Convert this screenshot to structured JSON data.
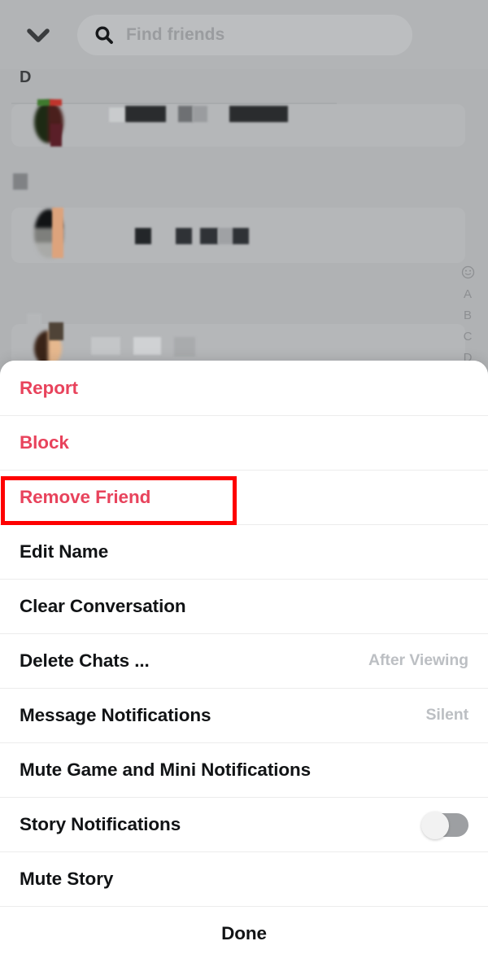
{
  "app": {
    "screen_title": "Friends list with action sheet",
    "accent_red": "#e8435c",
    "highlight_red": "#fe0000",
    "muted_gray": "#bcbfc3"
  },
  "background": {
    "back_chevron_icon": "chevron-down-icon",
    "search": {
      "icon": "search-icon",
      "placeholder": "Find friends",
      "value": ""
    },
    "section_header": "D",
    "alpha_index": {
      "smiley_icon": "smiley-face-icon",
      "letters": [
        "A",
        "B",
        "C",
        "D"
      ]
    },
    "friend_rows": [
      {
        "name_redacted": true
      },
      {
        "name_redacted": true
      },
      {
        "name_redacted": true
      }
    ]
  },
  "action_sheet": {
    "items": [
      {
        "label": "Report",
        "style": "danger",
        "value": "",
        "control": "none",
        "highlighted": false
      },
      {
        "label": "Block",
        "style": "danger",
        "value": "",
        "control": "none",
        "highlighted": false
      },
      {
        "label": "Remove Friend",
        "style": "danger",
        "value": "",
        "control": "none",
        "highlighted": true
      },
      {
        "label": "Edit Name",
        "style": "normal",
        "value": "",
        "control": "none",
        "highlighted": false
      },
      {
        "label": "Clear Conversation",
        "style": "normal",
        "value": "",
        "control": "none",
        "highlighted": false
      },
      {
        "label": "Delete Chats ...",
        "style": "normal",
        "value": "After Viewing",
        "control": "value",
        "highlighted": false
      },
      {
        "label": "Message Notifications",
        "style": "normal",
        "value": "Silent",
        "control": "value",
        "highlighted": false
      },
      {
        "label": "Mute Game and Mini Notifications",
        "style": "normal",
        "value": "",
        "control": "none",
        "highlighted": false
      },
      {
        "label": "Story Notifications",
        "style": "normal",
        "value": "",
        "control": "toggle",
        "toggle_on": false,
        "highlighted": false
      },
      {
        "label": "Mute Story",
        "style": "normal",
        "value": "",
        "control": "none",
        "highlighted": false
      }
    ],
    "done_label": "Done"
  }
}
